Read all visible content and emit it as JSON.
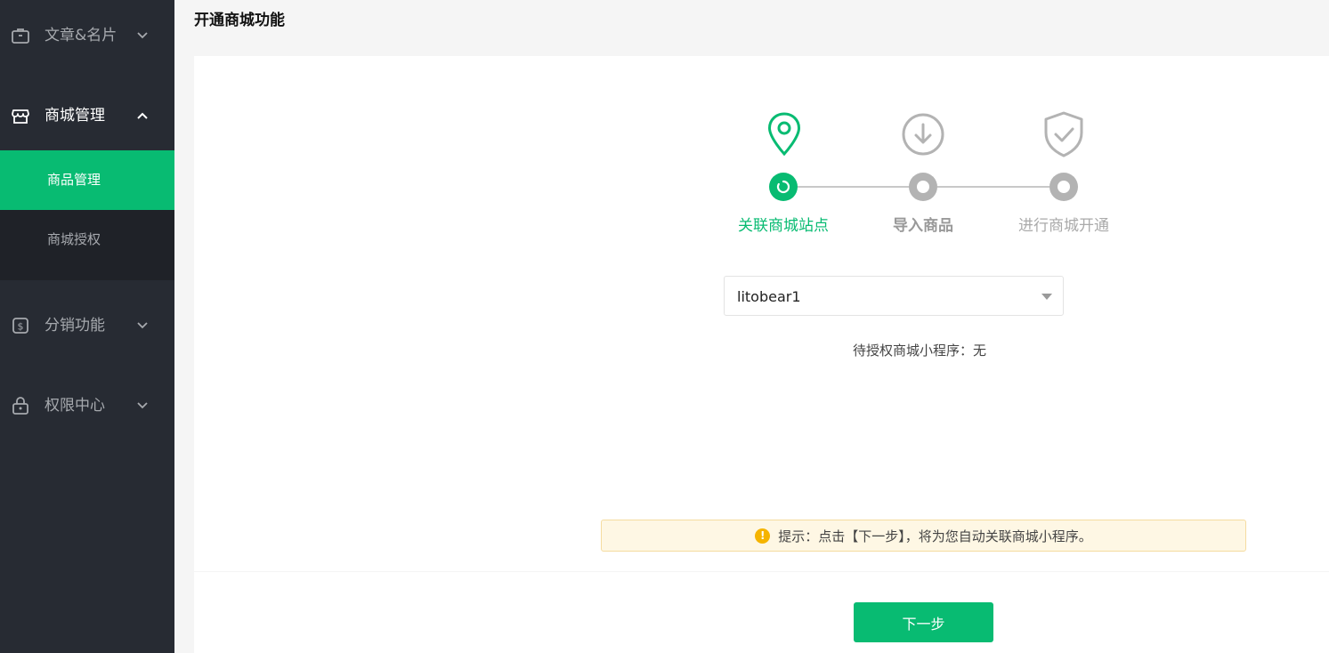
{
  "sidebar": {
    "groups": [
      {
        "label": "文章&名片",
        "icon": "briefcase-icon",
        "expanded": false
      },
      {
        "label": "商城管理",
        "icon": "store-icon",
        "expanded": true
      },
      {
        "label": "分销功能",
        "icon": "dollar-icon",
        "expanded": false
      },
      {
        "label": "权限中心",
        "icon": "lock-icon",
        "expanded": false
      }
    ],
    "sub_items": [
      {
        "label": "商品管理",
        "active": true
      },
      {
        "label": "商城授权",
        "active": false
      }
    ]
  },
  "page": {
    "title": "开通商城功能"
  },
  "steps": [
    {
      "label": "关联商城站点",
      "icon": "location-pin-icon",
      "status": "active"
    },
    {
      "label": "导入商品",
      "icon": "download-icon",
      "status": "pending"
    },
    {
      "label": "进行商城开通",
      "icon": "shield-check-icon",
      "status": "pending"
    }
  ],
  "site_select": {
    "value": "litobear1"
  },
  "pending_miniprogram": {
    "label": "待授权商城小程序：",
    "value": "无"
  },
  "tip": {
    "text": "提示：点击【下一步】，将为您自动关联商城小程序。"
  },
  "actions": {
    "next_label": "下一步"
  },
  "colors": {
    "accent": "#08bb72",
    "sidebar": "#272b33",
    "inactive": "#aaaaaa"
  }
}
